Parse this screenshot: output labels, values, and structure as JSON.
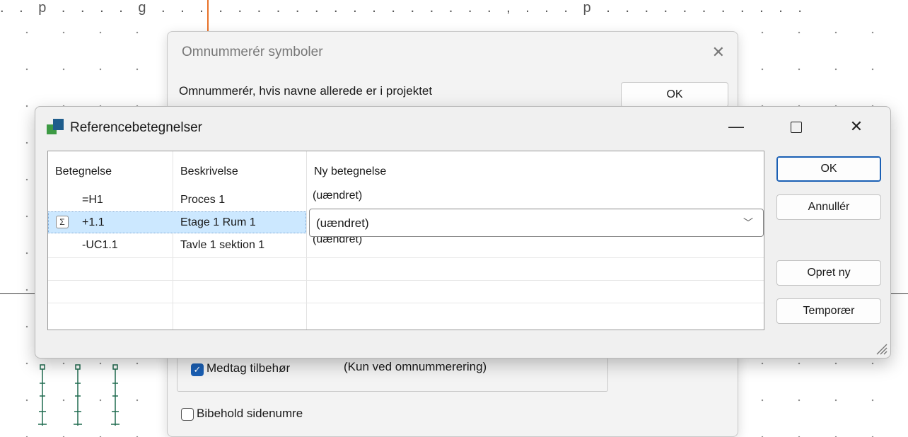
{
  "top_text": ". . p . . . . g . . . . . . . . . . . . . . . . . . , . . . p . . . . . . . . . . .",
  "background_dialog": {
    "title": "Omnummerér symboler",
    "label": "Omnummerér, hvis navne allerede er i projektet",
    "ok_label": "OK",
    "include_accessories": {
      "label": "Medtag tilbehør",
      "checked": true
    },
    "note": "(Kun ved omnummerering)",
    "keep_page_numbers": {
      "label": "Bibehold sidenumre",
      "checked": false
    }
  },
  "dialog": {
    "title": "Referencebetegnelser",
    "columns": [
      "Betegnelse",
      "Beskrivelse",
      "Ny betegnelse"
    ],
    "rows": [
      {
        "betegnelse": "=H1",
        "beskrivelse": "Proces 1",
        "ny": "(uændret)"
      },
      {
        "betegnelse": "+1.1",
        "beskrivelse": "Etage 1 Rum 1",
        "ny": "(uændret)"
      },
      {
        "betegnelse": "-UC1.1",
        "beskrivelse": "Tavle 1 sektion 1",
        "ny": "(uændret)"
      }
    ],
    "selected_row": 1,
    "combo_value": "(uændret)",
    "buttons": {
      "ok": "OK",
      "cancel": "Annullér",
      "create_new": "Opret ny",
      "temporary": "Temporær"
    }
  },
  "colors": {
    "accent": "#1a5fb4",
    "selection": "#cce8ff",
    "cursor_line": "#e8732a"
  }
}
